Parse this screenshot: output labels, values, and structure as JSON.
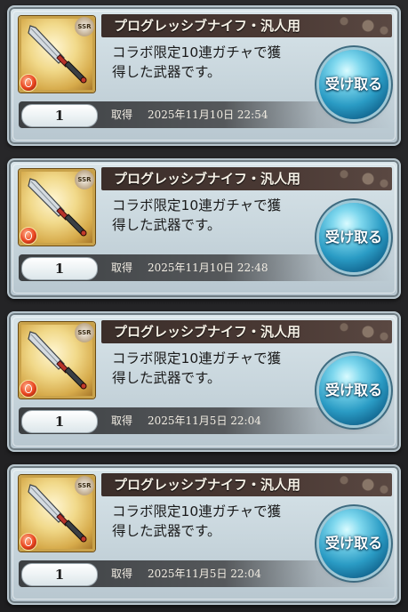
{
  "items": [
    {
      "title": "プログレッシブナイフ・汎人用",
      "desc_line1": "コラボ限定10連ガチャで獲",
      "desc_line2": "得した武器です。",
      "quantity": "1",
      "got_label": "取得",
      "date": "2025年11月10日 22:54",
      "button": "受け取る",
      "badge": "SSR"
    },
    {
      "title": "プログレッシブナイフ・汎人用",
      "desc_line1": "コラボ限定10連ガチャで獲",
      "desc_line2": "得した武器です。",
      "quantity": "1",
      "got_label": "取得",
      "date": "2025年11月10日 22:48",
      "button": "受け取る",
      "badge": "SSR"
    },
    {
      "title": "プログレッシブナイフ・汎人用",
      "desc_line1": "コラボ限定10連ガチャで獲",
      "desc_line2": "得した武器です。",
      "quantity": "1",
      "got_label": "取得",
      "date": "2025年11月5日 22:04",
      "button": "受け取る",
      "badge": "SSR"
    },
    {
      "title": "プログレッシブナイフ・汎人用",
      "desc_line1": "コラボ限定10連ガチャで獲",
      "desc_line2": "得した武器です。",
      "quantity": "1",
      "got_label": "取得",
      "date": "2025年11月5日 22:04",
      "button": "受け取る",
      "badge": "SSR"
    }
  ],
  "icons": {
    "weapon": "knife-icon",
    "element": "fire-element-icon",
    "rarity": "ssr-badge-icon"
  },
  "colors": {
    "button_blue": "#2a9bc4",
    "title_bar": "#3b2e2a",
    "card_bg": "#d9e5ea"
  }
}
